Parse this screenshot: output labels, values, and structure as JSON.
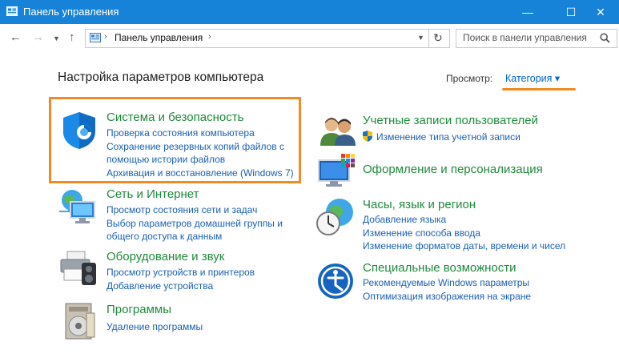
{
  "window": {
    "title": "Панель управления",
    "minimize": "—",
    "maximize": "☐",
    "close": "✕"
  },
  "addressbar": {
    "breadcrumb": "Панель управления",
    "search_placeholder": "Поиск в панели управления"
  },
  "page": {
    "heading": "Настройка параметров компьютера",
    "view_label": "Просмотр:",
    "view_value": "Категория ▾"
  },
  "left_categories": [
    {
      "title": "Система и безопасность",
      "links": [
        "Проверка состояния компьютера",
        "Сохранение резервных копий файлов с",
        "помощью истории файлов",
        "Архивация и восстановление (Windows 7)"
      ]
    },
    {
      "title": "Сеть и Интернет",
      "links": [
        "Просмотр состояния сети и задач",
        "Выбор параметров домашней группы и",
        "общего доступа к данным"
      ]
    },
    {
      "title": "Оборудование и звук",
      "links": [
        "Просмотр устройств и принтеров",
        "Добавление устройства"
      ]
    },
    {
      "title": "Программы",
      "links": [
        "Удаление программы"
      ]
    }
  ],
  "right_categories": [
    {
      "title": "Учетные записи пользователей",
      "links": [
        "Изменение типа учетной записи"
      ]
    },
    {
      "title": "Оформление и персонализация",
      "links": []
    },
    {
      "title": "Часы, язык и регион",
      "links": [
        "Добавление языка",
        "Изменение способа ввода",
        "Изменение форматов даты, времени и чисел"
      ]
    },
    {
      "title": "Специальные возможности",
      "links": [
        "Рекомендуемые Windows параметры",
        "Оптимизация изображения на экране"
      ]
    }
  ],
  "colors": {
    "titlebar": "#1683d8",
    "category_title": "#1e8a3a",
    "link": "#1a5fb4",
    "highlight": "#f08a24"
  }
}
